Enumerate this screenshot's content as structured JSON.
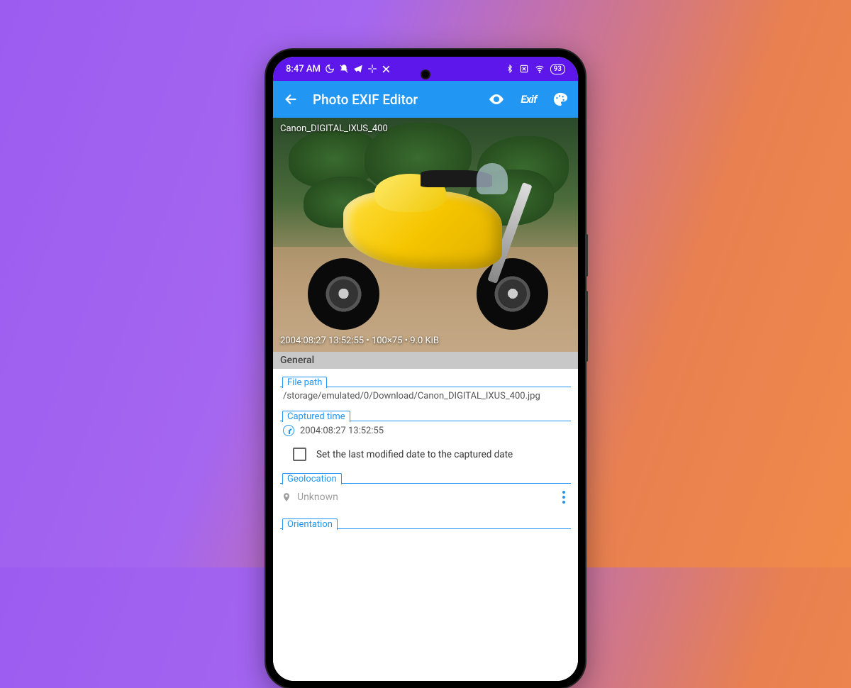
{
  "status_bar": {
    "time": "8:47 AM",
    "battery": "93"
  },
  "app_bar": {
    "title": "Photo EXIF Editor",
    "exif_label": "Exif"
  },
  "image": {
    "camera_model": "Canon_DIGITAL_IXUS_400",
    "meta_line": "2004:08:27 13:52:55 • 100×75 • 9.0 KiB"
  },
  "sections": {
    "general": "General"
  },
  "fields": {
    "file_path": {
      "label": "File path",
      "value": "/storage/emulated/0/Download/Canon_DIGITAL_IXUS_400.jpg"
    },
    "captured_time": {
      "label": "Captured time",
      "value": "2004:08:27 13:52:55"
    },
    "checkbox_label": "Set the last modified date to the captured date",
    "geolocation": {
      "label": "Geolocation",
      "value": "Unknown"
    },
    "orientation": {
      "label": "Orientation"
    }
  }
}
